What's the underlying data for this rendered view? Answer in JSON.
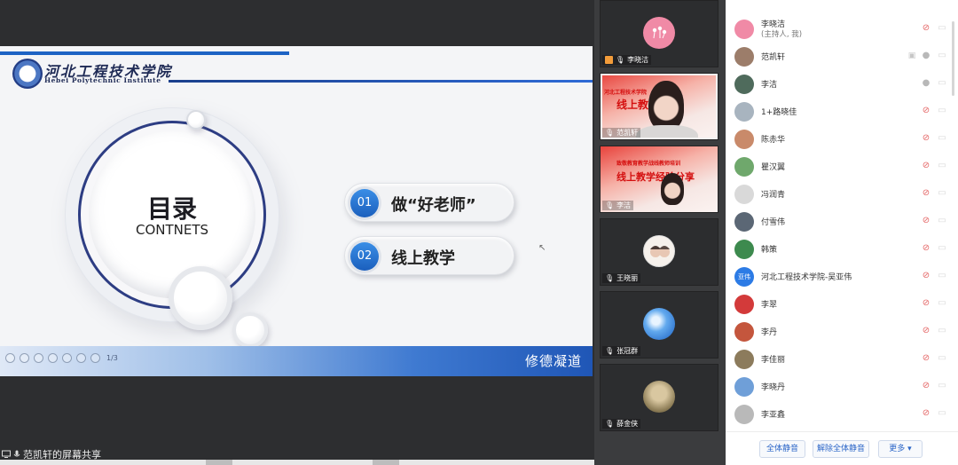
{
  "slide": {
    "school_cn": "河北工程技术学院",
    "school_en": "Hebei Polytechnic Institute",
    "toc_title": "目录",
    "toc_subtitle": "CONTNETS",
    "items": [
      {
        "num": "01",
        "text": "做“好老师”"
      },
      {
        "num": "02",
        "text": "线上教学"
      }
    ],
    "motto": "修德凝道",
    "tool_tag": "1/3"
  },
  "share_label": "范凯轩的屏幕共享",
  "video_tiles": [
    {
      "name": "李晓洁",
      "type": "avatar"
    },
    {
      "name": "范凯轩",
      "type": "camera",
      "banner_small": "河北工程技术学院",
      "banner_big": "线上教学"
    },
    {
      "name": "李洁",
      "type": "camera",
      "banner_small": "致敬教育教学战线教师培训",
      "banner_big": "线上教学经验分享"
    },
    {
      "name": "王晓丽",
      "type": "avatar"
    },
    {
      "name": "张冠群",
      "type": "avatar"
    },
    {
      "name": "薛金侠",
      "type": "avatar"
    }
  ],
  "participants": [
    {
      "name": "李晓洁",
      "note": "(主持人, 我)",
      "color": "#f08aa6",
      "mic": "off"
    },
    {
      "name": "范凯轩",
      "note": "",
      "color": "#9c7d6a",
      "mic": "on",
      "sharing": true
    },
    {
      "name": "李洁",
      "note": "",
      "color": "#4f6b5c",
      "mic": "on"
    },
    {
      "name": "1+路晓佳",
      "note": "",
      "color": "#a8b4bf",
      "mic": "off"
    },
    {
      "name": "陈赤华",
      "note": "",
      "color": "#c98a6a",
      "mic": "off"
    },
    {
      "name": "瞿汉翼",
      "note": "",
      "color": "#6fa86c",
      "mic": "off"
    },
    {
      "name": "冯润青",
      "note": "",
      "color": "#d9d9d9",
      "mic": "off"
    },
    {
      "name": "付雪伟",
      "note": "",
      "color": "#5b6775",
      "mic": "off"
    },
    {
      "name": "韩策",
      "note": "",
      "color": "#3d8a4e",
      "mic": "off"
    },
    {
      "name": "河北工程技术学院-吴亚伟",
      "note": "",
      "color": "#2c7be5",
      "avatar_text": "亚伟",
      "mic": "off"
    },
    {
      "name": "李翠",
      "note": "",
      "color": "#d33a3a",
      "mic": "off"
    },
    {
      "name": "李丹",
      "note": "",
      "color": "#c4563d",
      "mic": "off"
    },
    {
      "name": "李佳丽",
      "note": "",
      "color": "#8c7b5c",
      "mic": "off"
    },
    {
      "name": "李晓丹",
      "note": "",
      "color": "#6f9fd8",
      "mic": "off"
    },
    {
      "name": "李亚鑫",
      "note": "",
      "color": "#b9b9b9",
      "mic": "off"
    }
  ],
  "footer_buttons": {
    "mute_all": "全体静音",
    "unmute_all": "解除全体静音",
    "more": "更多 ▾"
  },
  "icons": {
    "mic_off": "mic-off-icon",
    "mic_on": "mic-icon",
    "camera_off": "camera-off-icon",
    "screen_share": "screen-share-icon"
  }
}
